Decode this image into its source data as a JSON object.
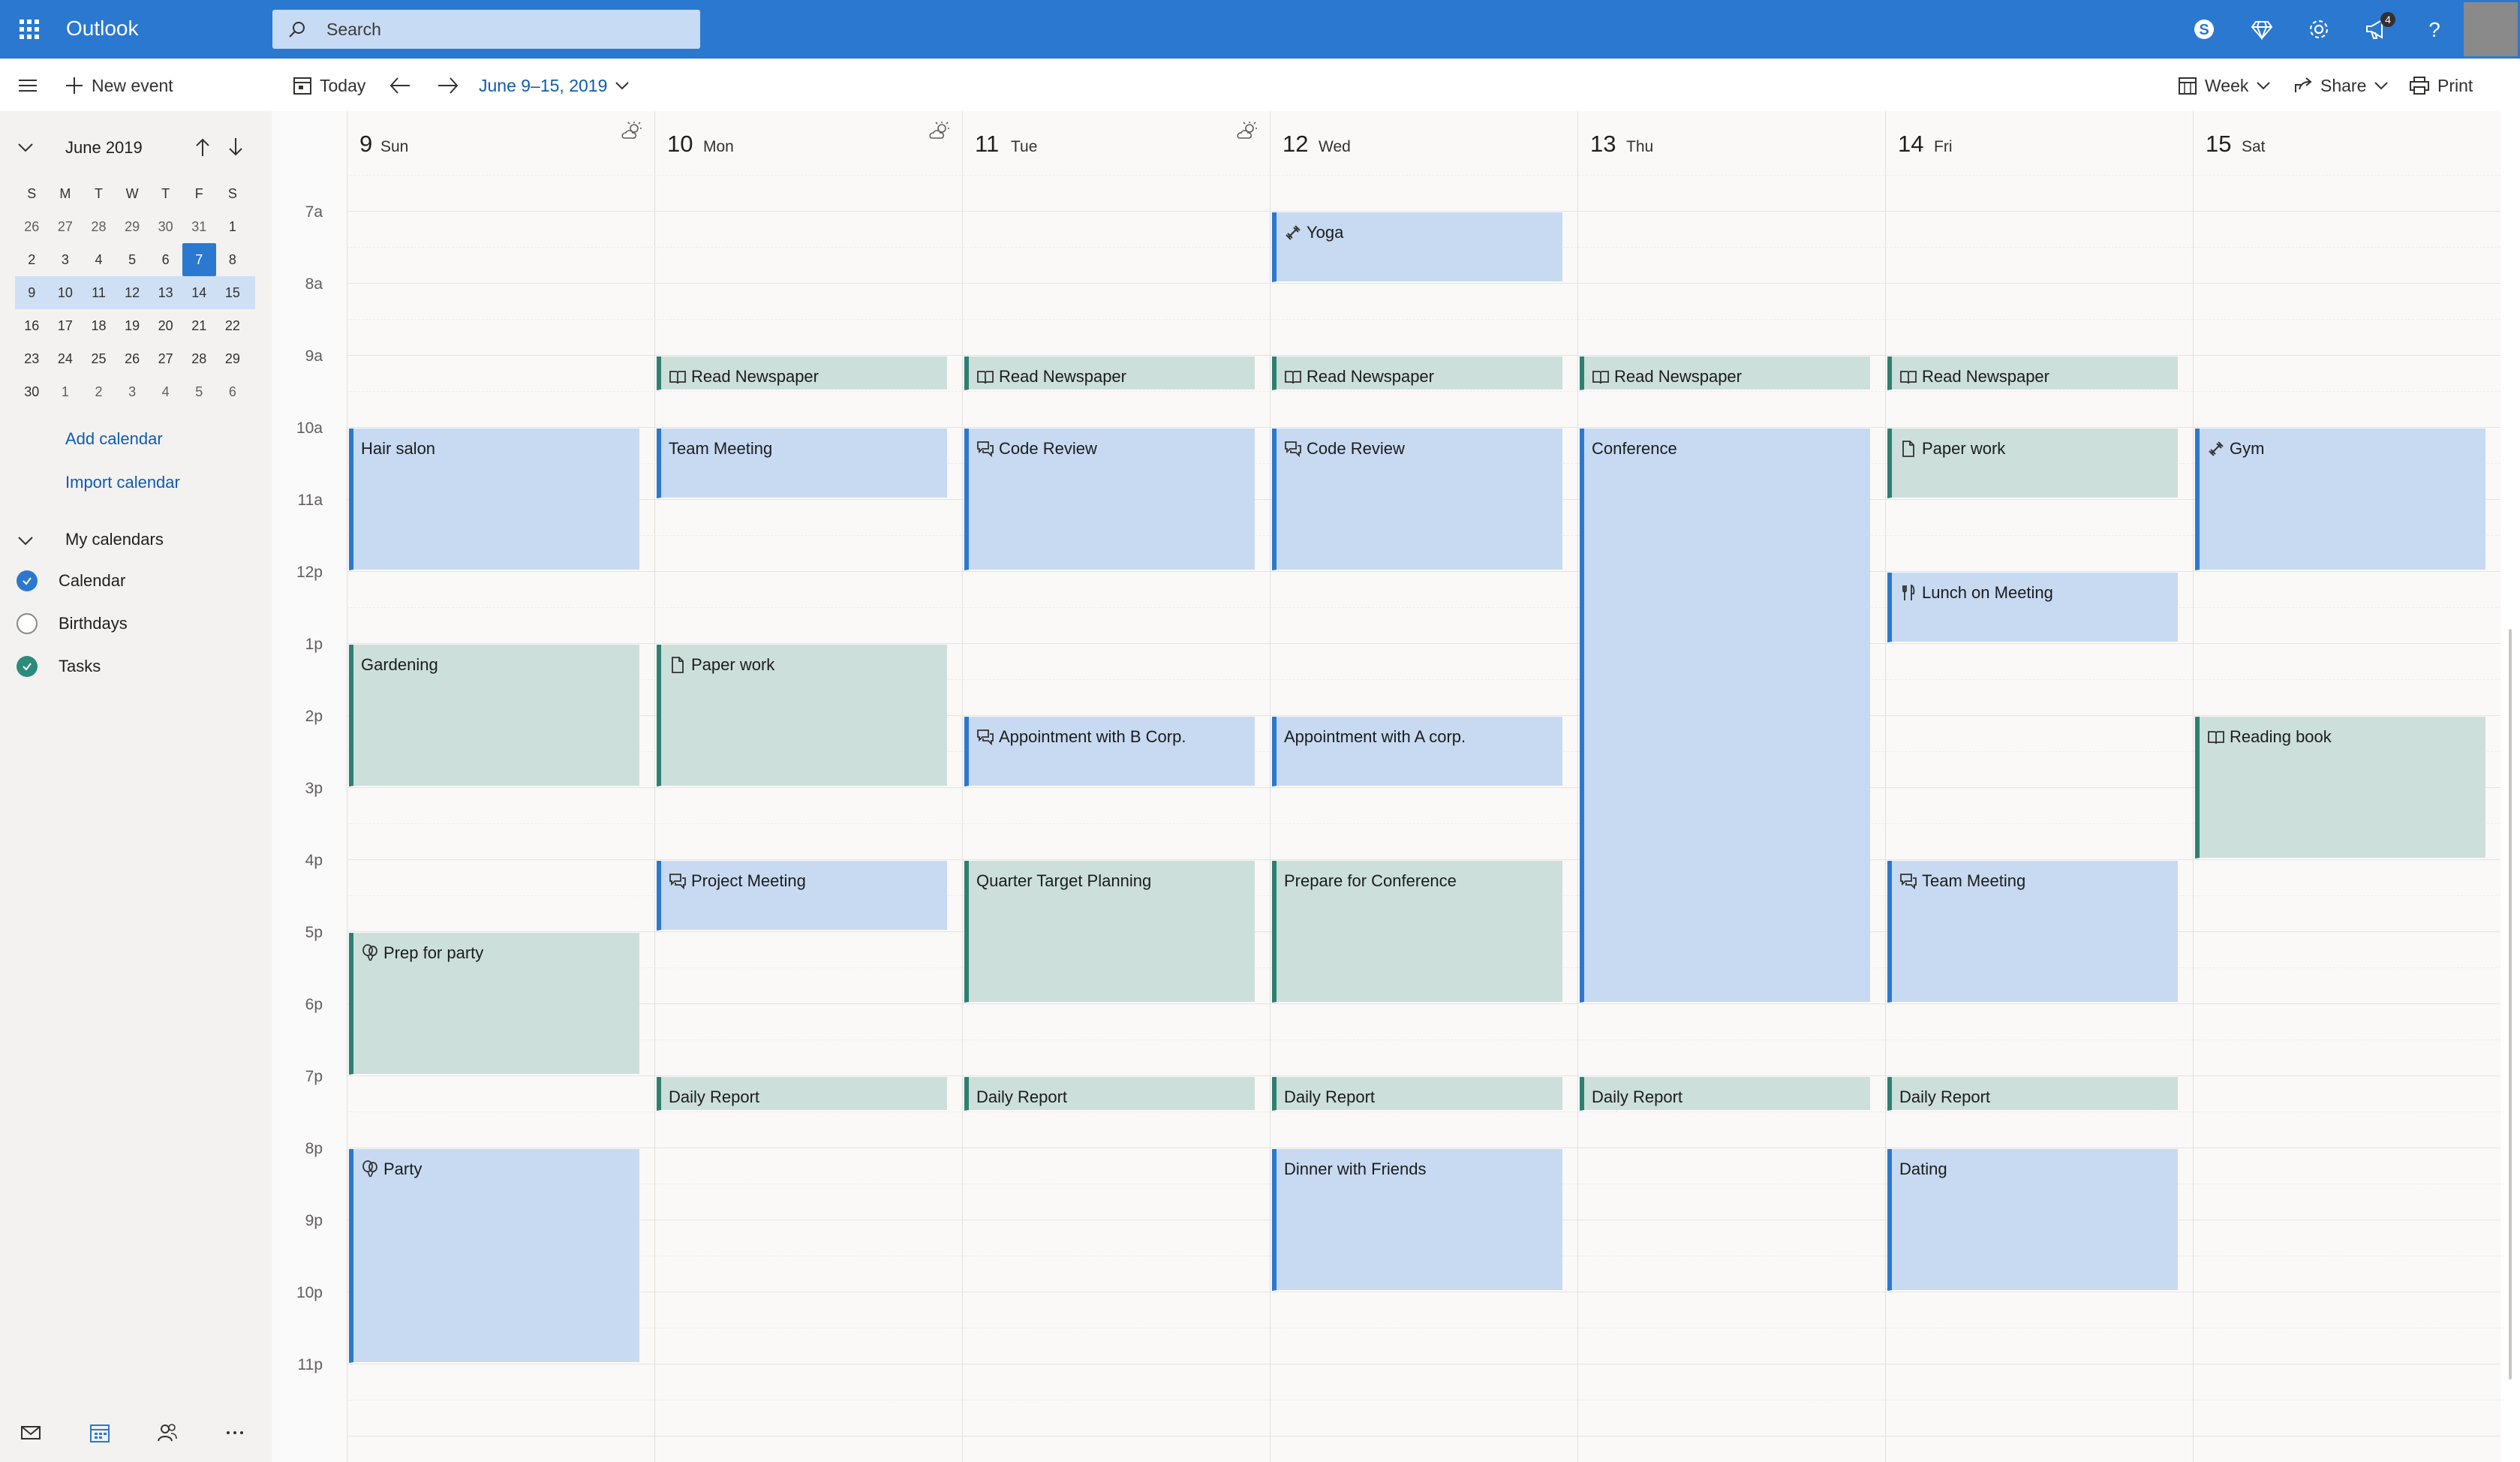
{
  "app": {
    "title": "Outlook"
  },
  "search": {
    "placeholder": "Search"
  },
  "notifications": {
    "count": "4"
  },
  "toolbar": {
    "new_event": "New event",
    "today": "Today",
    "date_range": "June 9–15, 2019",
    "view": "Week",
    "share": "Share",
    "print": "Print"
  },
  "mini_calendar": {
    "month": "June 2019",
    "dow": [
      "S",
      "M",
      "T",
      "W",
      "T",
      "F",
      "S"
    ],
    "weeks": [
      [
        "26",
        "27",
        "28",
        "29",
        "30",
        "31",
        "1"
      ],
      [
        "2",
        "3",
        "4",
        "5",
        "6",
        "7",
        "8"
      ],
      [
        "9",
        "10",
        "11",
        "12",
        "13",
        "14",
        "15"
      ],
      [
        "16",
        "17",
        "18",
        "19",
        "20",
        "21",
        "22"
      ],
      [
        "23",
        "24",
        "25",
        "26",
        "27",
        "28",
        "29"
      ],
      [
        "30",
        "1",
        "2",
        "3",
        "4",
        "5",
        "6"
      ]
    ],
    "today": "7",
    "selected_week_index": 2
  },
  "links": {
    "add_calendar": "Add calendar",
    "import_calendar": "Import calendar"
  },
  "my_calendars": {
    "title": "My calendars",
    "items": [
      {
        "label": "Calendar",
        "checked": true,
        "color": "#2b78d0"
      },
      {
        "label": "Birthdays",
        "checked": false,
        "color": "#8a8886"
      },
      {
        "label": "Tasks",
        "checked": true,
        "color": "#2d8b7b"
      }
    ]
  },
  "days": [
    {
      "num": "9",
      "name": "Sun",
      "weather": true
    },
    {
      "num": "10",
      "name": "Mon",
      "weather": true
    },
    {
      "num": "11",
      "name": "Tue",
      "weather": true
    },
    {
      "num": "12",
      "name": "Wed",
      "weather": false
    },
    {
      "num": "13",
      "name": "Thu",
      "weather": false
    },
    {
      "num": "14",
      "name": "Fri",
      "weather": false
    },
    {
      "num": "15",
      "name": "Sat",
      "weather": false
    }
  ],
  "hours": [
    "7a",
    "8a",
    "9a",
    "10a",
    "11a",
    "12p",
    "1p",
    "2p",
    "3p",
    "4p",
    "5p",
    "6p",
    "7p",
    "8p",
    "9p",
    "10p",
    "11p"
  ],
  "events": [
    {
      "day": 3,
      "start": "7:00",
      "end": "8:00",
      "title": "Yoga",
      "color": "blue",
      "icon": "exercise"
    },
    {
      "day": 1,
      "start": "9:00",
      "end": "9:30",
      "title": "Read Newspaper",
      "color": "green",
      "icon": "book"
    },
    {
      "day": 2,
      "start": "9:00",
      "end": "9:30",
      "title": "Read Newspaper",
      "color": "green",
      "icon": "book"
    },
    {
      "day": 3,
      "start": "9:00",
      "end": "9:30",
      "title": "Read Newspaper",
      "color": "green",
      "icon": "book"
    },
    {
      "day": 4,
      "start": "9:00",
      "end": "9:30",
      "title": "Read Newspaper",
      "color": "green",
      "icon": "book"
    },
    {
      "day": 5,
      "start": "9:00",
      "end": "9:30",
      "title": "Read Newspaper",
      "color": "green",
      "icon": "book"
    },
    {
      "day": 0,
      "start": "10:00",
      "end": "12:00",
      "title": "Hair salon",
      "color": "blue",
      "icon": ""
    },
    {
      "day": 1,
      "start": "10:00",
      "end": "11:00",
      "title": "Team Meeting",
      "color": "blue",
      "icon": ""
    },
    {
      "day": 2,
      "start": "10:00",
      "end": "12:00",
      "title": "Code Review",
      "color": "blue",
      "icon": "chat"
    },
    {
      "day": 3,
      "start": "10:00",
      "end": "12:00",
      "title": "Code Review",
      "color": "blue",
      "icon": "chat"
    },
    {
      "day": 4,
      "start": "10:00",
      "end": "18:00",
      "title": "Conference",
      "color": "blue",
      "icon": ""
    },
    {
      "day": 5,
      "start": "10:00",
      "end": "11:00",
      "title": "Paper work",
      "color": "green",
      "icon": "document"
    },
    {
      "day": 6,
      "start": "10:00",
      "end": "12:00",
      "title": "Gym",
      "color": "blue",
      "icon": "exercise"
    },
    {
      "day": 5,
      "start": "12:00",
      "end": "13:00",
      "title": "Lunch on Meeting",
      "color": "blue",
      "icon": "food"
    },
    {
      "day": 0,
      "start": "13:00",
      "end": "15:00",
      "title": "Gardening",
      "color": "green",
      "icon": ""
    },
    {
      "day": 1,
      "start": "13:00",
      "end": "15:00",
      "title": "Paper work",
      "color": "green",
      "icon": "document"
    },
    {
      "day": 2,
      "start": "14:00",
      "end": "15:00",
      "title": "Appointment with B Corp.",
      "color": "blue",
      "icon": "chat"
    },
    {
      "day": 3,
      "start": "14:00",
      "end": "15:00",
      "title": "Appointment with A corp.",
      "color": "blue",
      "icon": ""
    },
    {
      "day": 6,
      "start": "14:00",
      "end": "16:00",
      "title": "Reading book",
      "color": "green",
      "icon": "book"
    },
    {
      "day": 1,
      "start": "16:00",
      "end": "17:00",
      "title": "Project Meeting",
      "color": "blue",
      "icon": "chat"
    },
    {
      "day": 2,
      "start": "16:00",
      "end": "18:00",
      "title": "Quarter Target Planning",
      "color": "green",
      "icon": ""
    },
    {
      "day": 3,
      "start": "16:00",
      "end": "18:00",
      "title": "Prepare for Conference",
      "color": "green",
      "icon": ""
    },
    {
      "day": 5,
      "start": "16:00",
      "end": "18:00",
      "title": "Team Meeting",
      "color": "blue",
      "icon": "chat"
    },
    {
      "day": 0,
      "start": "17:00",
      "end": "19:00",
      "title": "Prep for party",
      "color": "green",
      "icon": "balloon"
    },
    {
      "day": 1,
      "start": "19:00",
      "end": "19:30",
      "title": "Daily Report",
      "color": "green",
      "icon": ""
    },
    {
      "day": 2,
      "start": "19:00",
      "end": "19:30",
      "title": "Daily Report",
      "color": "green",
      "icon": ""
    },
    {
      "day": 3,
      "start": "19:00",
      "end": "19:30",
      "title": "Daily Report",
      "color": "green",
      "icon": ""
    },
    {
      "day": 4,
      "start": "19:00",
      "end": "19:30",
      "title": "Daily Report",
      "color": "green",
      "icon": ""
    },
    {
      "day": 5,
      "start": "19:00",
      "end": "19:30",
      "title": "Daily Report",
      "color": "green",
      "icon": ""
    },
    {
      "day": 0,
      "start": "20:00",
      "end": "23:00",
      "title": "Party",
      "color": "blue",
      "icon": "balloon"
    },
    {
      "day": 3,
      "start": "20:00",
      "end": "22:00",
      "title": "Dinner with Friends",
      "color": "blue",
      "icon": ""
    },
    {
      "day": 5,
      "start": "20:00",
      "end": "22:00",
      "title": "Dating",
      "color": "blue",
      "icon": ""
    }
  ]
}
